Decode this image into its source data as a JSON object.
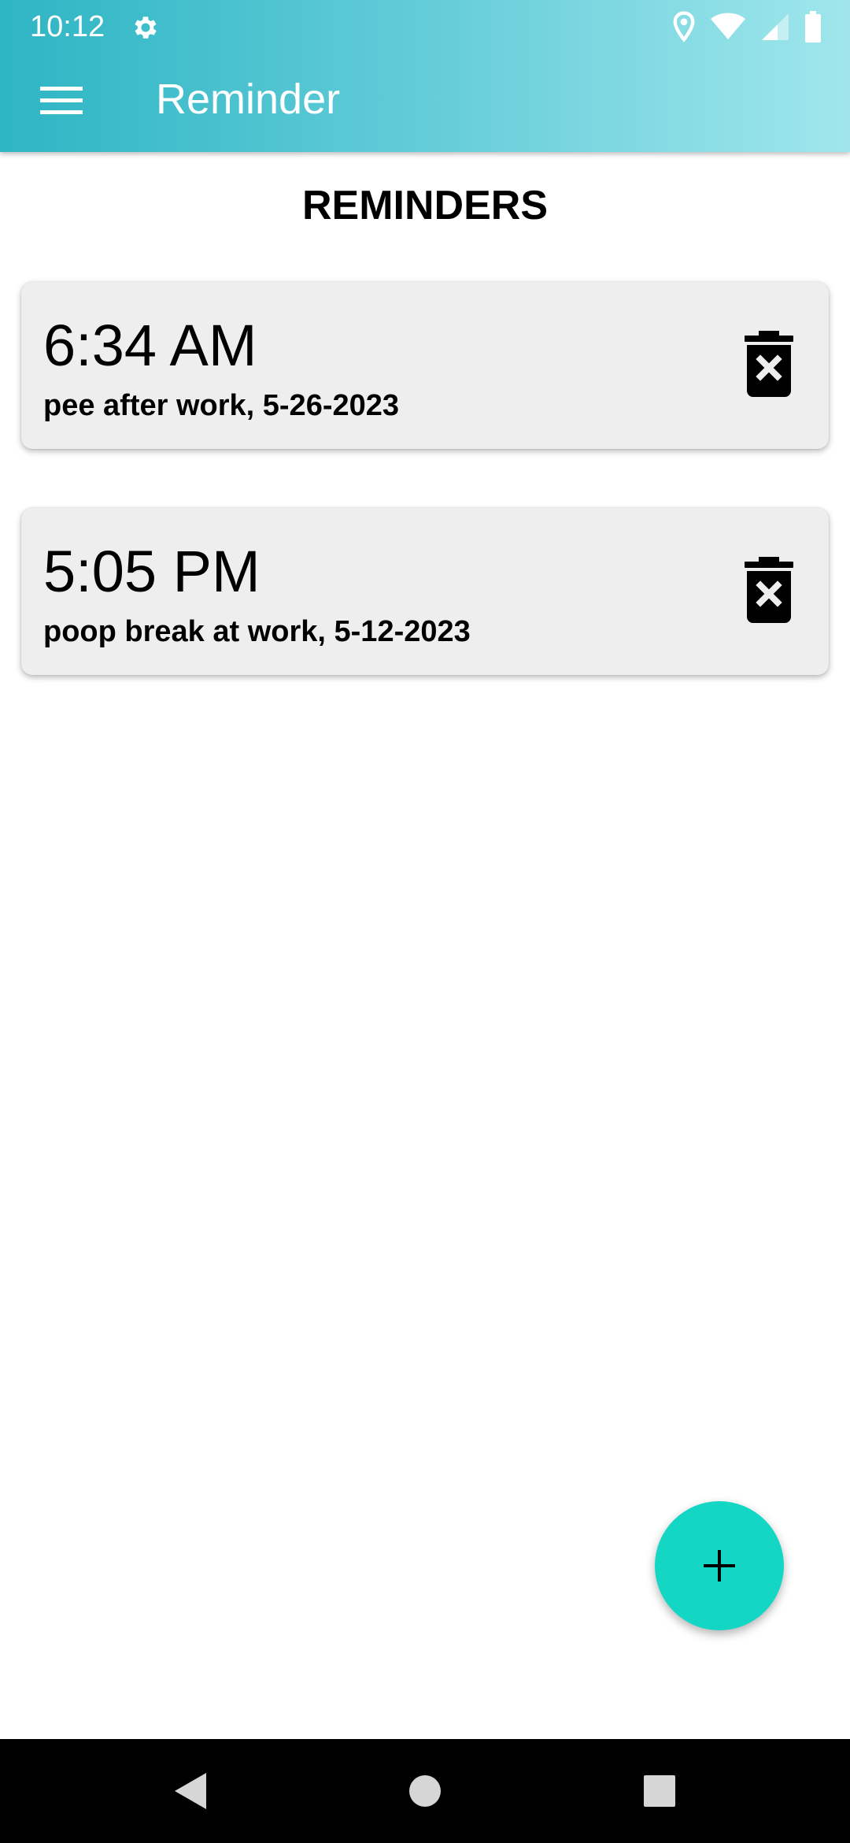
{
  "status_bar": {
    "time": "10:12",
    "icons": [
      "settings-icon",
      "location-icon",
      "wifi-icon",
      "signal-icon",
      "battery-icon"
    ]
  },
  "toolbar": {
    "title": "Reminder",
    "menu_icon": "hamburger-menu-icon"
  },
  "page": {
    "title": "REMINDERS"
  },
  "reminders": [
    {
      "time": "6:34 AM",
      "description": "pee after work, 5-26-2023"
    },
    {
      "time": "5:05 PM",
      "description": "poop break at work, 5-12-2023"
    }
  ],
  "fab": {
    "icon": "plus-icon"
  },
  "nav_bar": {
    "buttons": [
      "back-icon",
      "home-icon",
      "recents-icon"
    ]
  },
  "colors": {
    "appbar_start": "#2eb5c4",
    "appbar_end": "#a0e6ec",
    "card_bg": "#eeeeee",
    "fab": "#14d6c4"
  }
}
